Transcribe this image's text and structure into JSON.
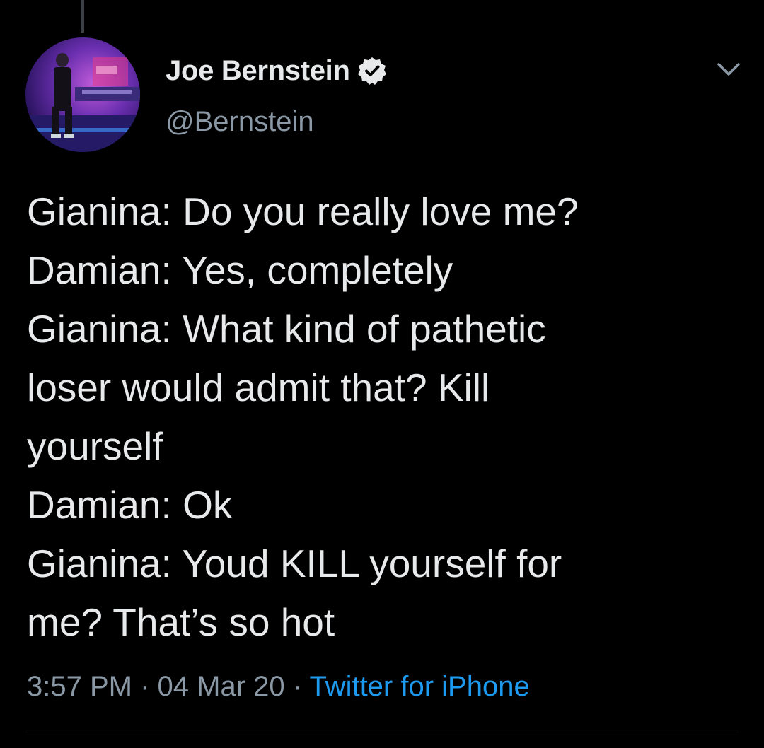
{
  "author": {
    "display_name": "Joe Bernstein",
    "handle": "@Bernstein",
    "verified": true,
    "avatar_icon": "profile-photo"
  },
  "tweet": {
    "lines": [
      "Gianina: Do you really love me?",
      "Damian: Yes, completely",
      "Gianina: What kind of pathetic",
      "loser would admit that? Kill",
      "yourself",
      "Damian: Ok",
      "Gianina: Youd KILL yourself for",
      "me? That’s so hot"
    ]
  },
  "meta": {
    "time": "3:57 PM",
    "separator": " · ",
    "date": "04 Mar 20",
    "source": "Twitter for iPhone"
  },
  "icons": {
    "verified": "verified-badge-icon",
    "menu": "chevron-down-icon"
  },
  "colors": {
    "background": "#000000",
    "text_primary": "#e7e9ea",
    "text_secondary": "#8b98a5",
    "link": "#1d9bf0",
    "divider": "#2f3336"
  }
}
